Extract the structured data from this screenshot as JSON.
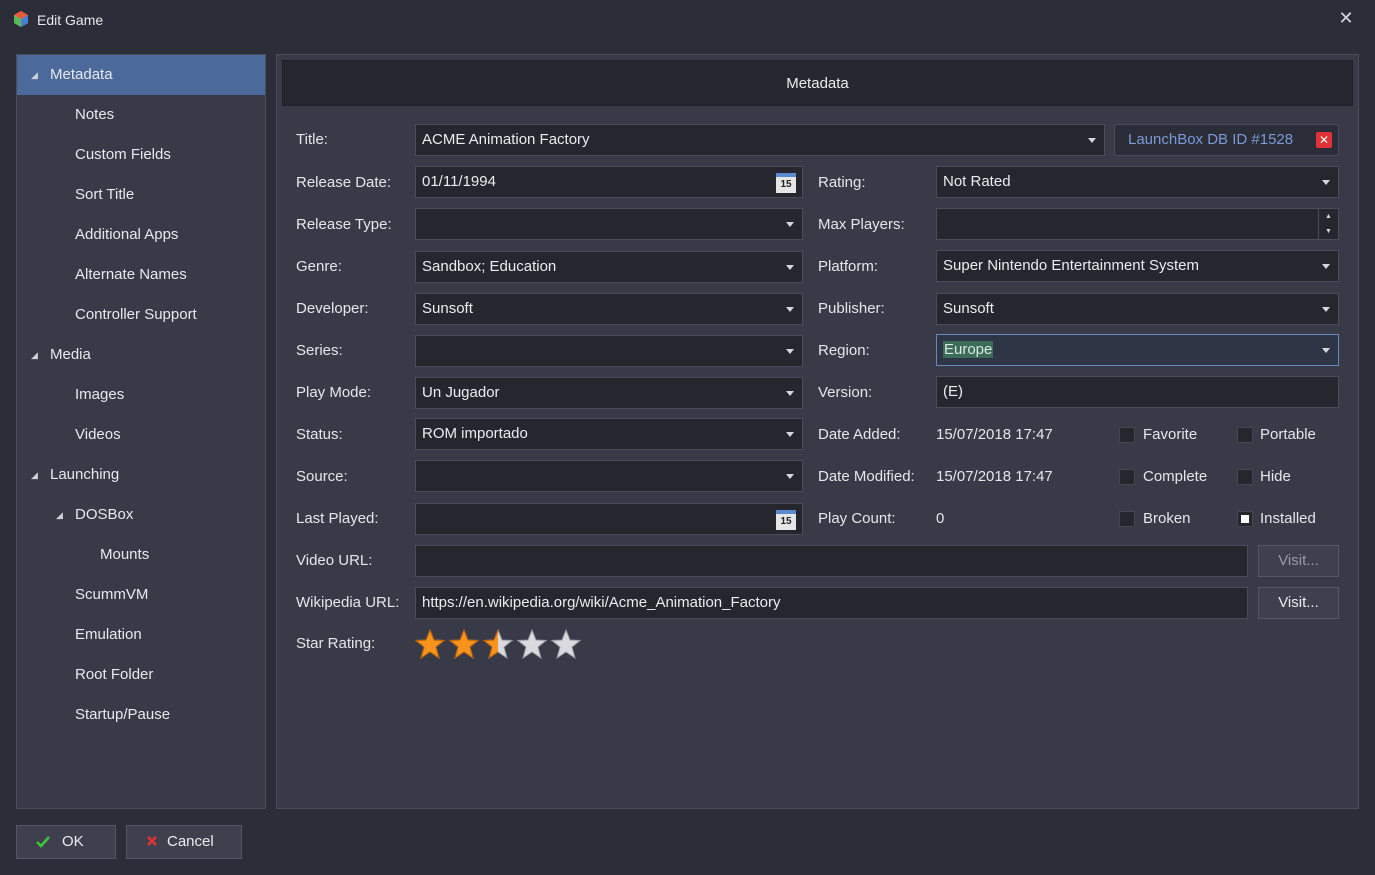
{
  "window": {
    "title": "Edit Game",
    "close_icon": "close-icon"
  },
  "sidebar": {
    "items": [
      {
        "label": "Metadata",
        "level": 0,
        "expander": true,
        "selected": true
      },
      {
        "label": "Notes",
        "level": 1
      },
      {
        "label": "Custom Fields",
        "level": 1
      },
      {
        "label": "Sort Title",
        "level": 1
      },
      {
        "label": "Additional Apps",
        "level": 1
      },
      {
        "label": "Alternate Names",
        "level": 1
      },
      {
        "label": "Controller Support",
        "level": 1
      },
      {
        "label": "Media",
        "level": 0,
        "expander": true
      },
      {
        "label": "Images",
        "level": 1
      },
      {
        "label": "Videos",
        "level": 1
      },
      {
        "label": "Launching",
        "level": 0,
        "expander": true
      },
      {
        "label": "DOSBox",
        "level": 1,
        "expander": true
      },
      {
        "label": "Mounts",
        "level": 2
      },
      {
        "label": "ScummVM",
        "level": 1
      },
      {
        "label": "Emulation",
        "level": 1
      },
      {
        "label": "Root Folder",
        "level": 1
      },
      {
        "label": "Startup/Pause",
        "level": 1
      }
    ]
  },
  "header": {
    "title": "Metadata"
  },
  "form": {
    "title_label": "Title:",
    "title_value": "ACME Animation Factory",
    "dbid": "LaunchBox DB ID #1528",
    "release_date_label": "Release Date:",
    "release_date_value": "01/11/1994",
    "rating_label": "Rating:",
    "rating_value": "Not Rated",
    "release_type_label": "Release Type:",
    "release_type_value": "",
    "max_players_label": "Max Players:",
    "max_players_value": "",
    "genre_label": "Genre:",
    "genre_value": "Sandbox; Education",
    "platform_label": "Platform:",
    "platform_value": "Super Nintendo Entertainment System",
    "developer_label": "Developer:",
    "developer_value": "Sunsoft",
    "publisher_label": "Publisher:",
    "publisher_value": "Sunsoft",
    "series_label": "Series:",
    "series_value": "",
    "region_label": "Region:",
    "region_value": "Europe",
    "play_mode_label": "Play Mode:",
    "play_mode_value": "Un Jugador",
    "version_label": "Version:",
    "version_value": "(E)",
    "status_label": "Status:",
    "status_value": "ROM importado",
    "date_added_label": "Date Added:",
    "date_added_value": "15/07/2018 17:47",
    "source_label": "Source:",
    "source_value": "",
    "date_modified_label": "Date Modified:",
    "date_modified_value": "15/07/2018 17:47",
    "last_played_label": "Last Played:",
    "last_played_value": "",
    "play_count_label": "Play Count:",
    "play_count_value": "0",
    "video_url_label": "Video URL:",
    "video_url_value": "",
    "wikipedia_url_label": "Wikipedia URL:",
    "wikipedia_url_value": "https://en.wikipedia.org/wiki/Acme_Animation_Factory",
    "visit_label": "Visit...",
    "star_rating_label": "Star Rating:",
    "star_rating_value": 2.5,
    "star_rating_max": 5,
    "calendar_day": "15"
  },
  "checkboxes": {
    "favorite": {
      "label": "Favorite",
      "checked": false
    },
    "portable": {
      "label": "Portable",
      "checked": false
    },
    "complete": {
      "label": "Complete",
      "checked": false
    },
    "hide": {
      "label": "Hide",
      "checked": false
    },
    "broken": {
      "label": "Broken",
      "checked": false
    },
    "installed": {
      "label": "Installed",
      "checked": true
    }
  },
  "footer": {
    "ok_label": "OK",
    "cancel_label": "Cancel"
  },
  "colors": {
    "selection": "#4b6a9b",
    "link": "#7b9ad6",
    "star": "#f7941d",
    "accept": "#3cc43c",
    "cancel": "#e03232"
  }
}
